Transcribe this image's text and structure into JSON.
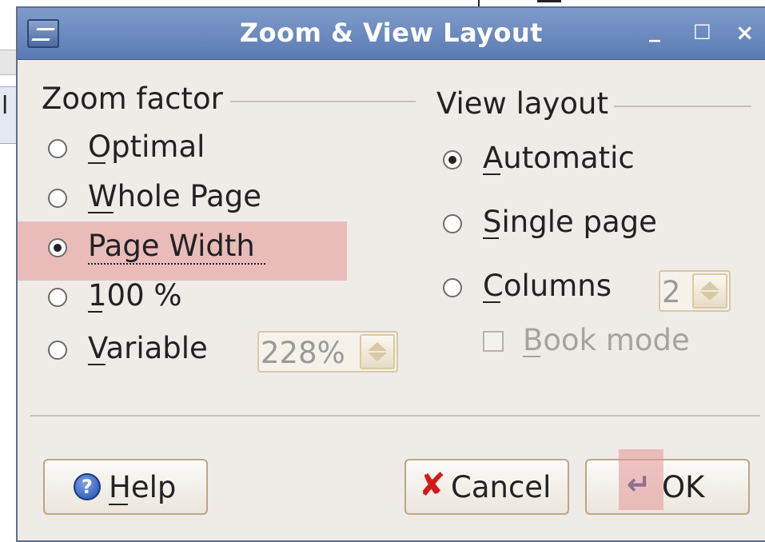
{
  "dialog": {
    "title": "Zoom & View Layout",
    "icons": [
      "app-icon",
      "minimize-icon",
      "maximize-icon",
      "close-icon"
    ],
    "window_controls": {
      "minimize": "_",
      "maximize": "□",
      "close": "×"
    }
  },
  "zoom_factor": {
    "title": "Zoom factor",
    "options": [
      {
        "label": "Optimal",
        "selected": false
      },
      {
        "label": "Whole Page",
        "selected": false
      },
      {
        "label": "Page Width",
        "selected": true
      },
      {
        "label": "100 %",
        "selected": false
      },
      {
        "label": "Variable",
        "selected": false
      }
    ],
    "variable_value": "228%"
  },
  "view_layout": {
    "title": "View layout",
    "options": [
      {
        "label": "Automatic",
        "selected": true
      },
      {
        "label": "Single page",
        "selected": false
      },
      {
        "label": "Columns",
        "selected": false
      }
    ],
    "columns_value": "2",
    "book_mode": {
      "label": "Book mode",
      "checked": false,
      "enabled": false
    }
  },
  "buttons": {
    "help": "Help",
    "cancel": "Cancel",
    "ok": "OK"
  },
  "background": {
    "partial_text": "l"
  },
  "colors": {
    "titlebar": "#6b8bc0",
    "dialog_bg": "#efebe7",
    "highlight": "#e49696",
    "cancel_icon": "#d31a1a",
    "help_icon": "#1f4db0"
  }
}
